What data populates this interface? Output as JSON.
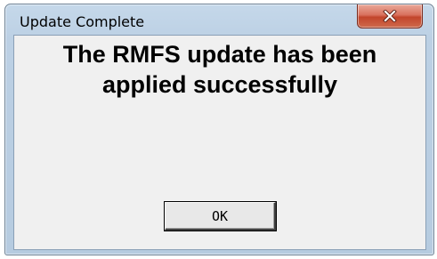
{
  "window": {
    "title": "Update Complete"
  },
  "titlebar": {
    "close_icon": "close-x-icon"
  },
  "dialog": {
    "message_line1": "The RMFS update has been",
    "message_line2": "applied successfully",
    "ok_label": "OK"
  },
  "colors": {
    "close_button": "#c9553a",
    "frame": "#bcd0e4",
    "client_bg": "#f0f0f0"
  }
}
